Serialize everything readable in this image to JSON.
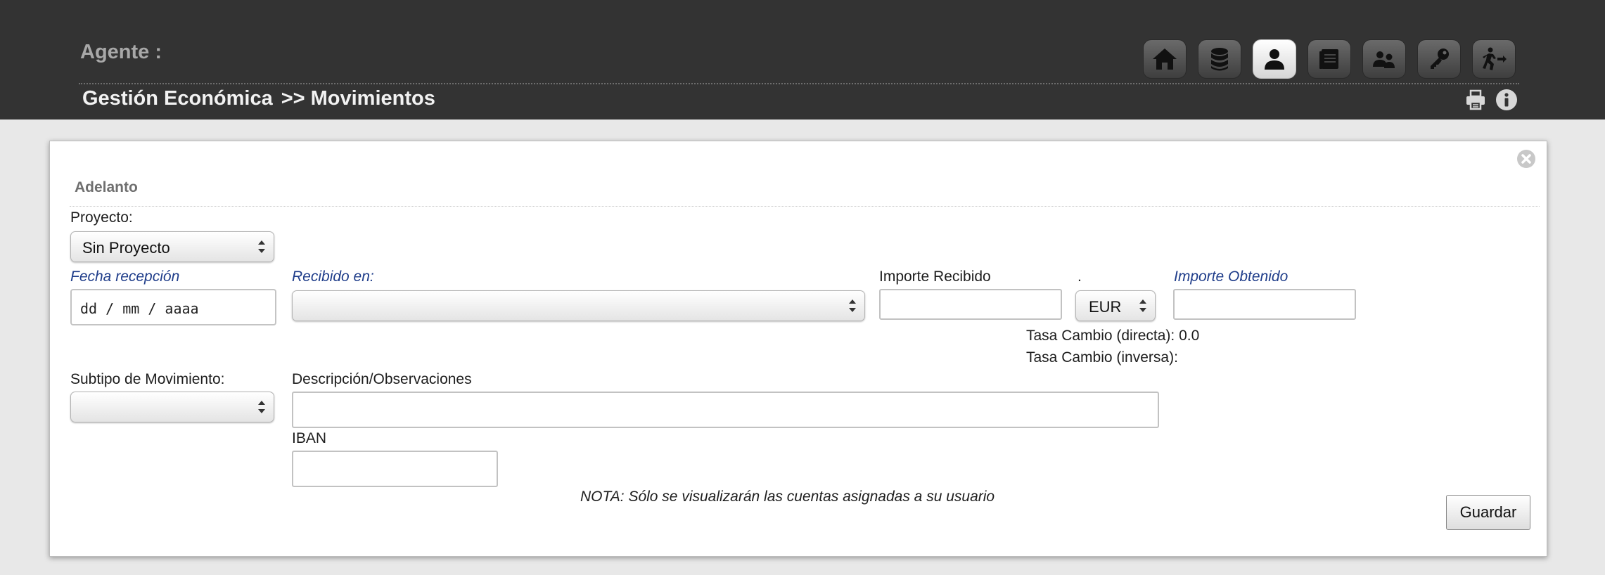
{
  "header": {
    "agent_label": "Agente :",
    "breadcrumb": {
      "section": "Gestión Económica",
      "separator": ">>",
      "page": "Movimientos"
    }
  },
  "nav_icons": [
    "home-icon",
    "database-icon",
    "user-icon",
    "book-icon",
    "users-icon",
    "key-icon",
    "exit-icon"
  ],
  "active_nav": "user-icon",
  "utility_icons": [
    "printer-icon",
    "info-icon"
  ],
  "panel": {
    "title": "Adelanto",
    "form": {
      "proyecto_label": "Proyecto:",
      "proyecto_value": "Sin Proyecto",
      "fecha_label": "Fecha recepción",
      "fecha_placeholder": "dd / mm / aaaa",
      "recibido_label": "Recibido en:",
      "recibido_value": "",
      "importe_recibido_label": "Importe Recibido",
      "importe_recibido_value": "",
      "currency_label": ".",
      "currency_value": "EUR",
      "importe_obtenido_label": "Importe Obtenido",
      "importe_obtenido_value": "",
      "tasa_directa_label": "Tasa Cambio (directa):",
      "tasa_directa_value": "0.0",
      "tasa_inversa_label": "Tasa Cambio (inversa):",
      "tasa_inversa_value": "",
      "subtipo_label": "Subtipo de Movimiento:",
      "subtipo_value": "",
      "descripcion_label": "Descripción/Observaciones",
      "descripcion_value": "",
      "iban_label": "IBAN",
      "iban_value": ""
    },
    "note": "NOTA: Sólo se visualizarán las cuentas asignadas a su usuario",
    "save_label": "Guardar"
  },
  "colors": {
    "header_bg": "#333333",
    "agent_text": "#a8a8a8",
    "breadcrumb_text": "#f2f2f2",
    "required_label": "#1f3d8a",
    "page_bg": "#e8e8e8"
  }
}
